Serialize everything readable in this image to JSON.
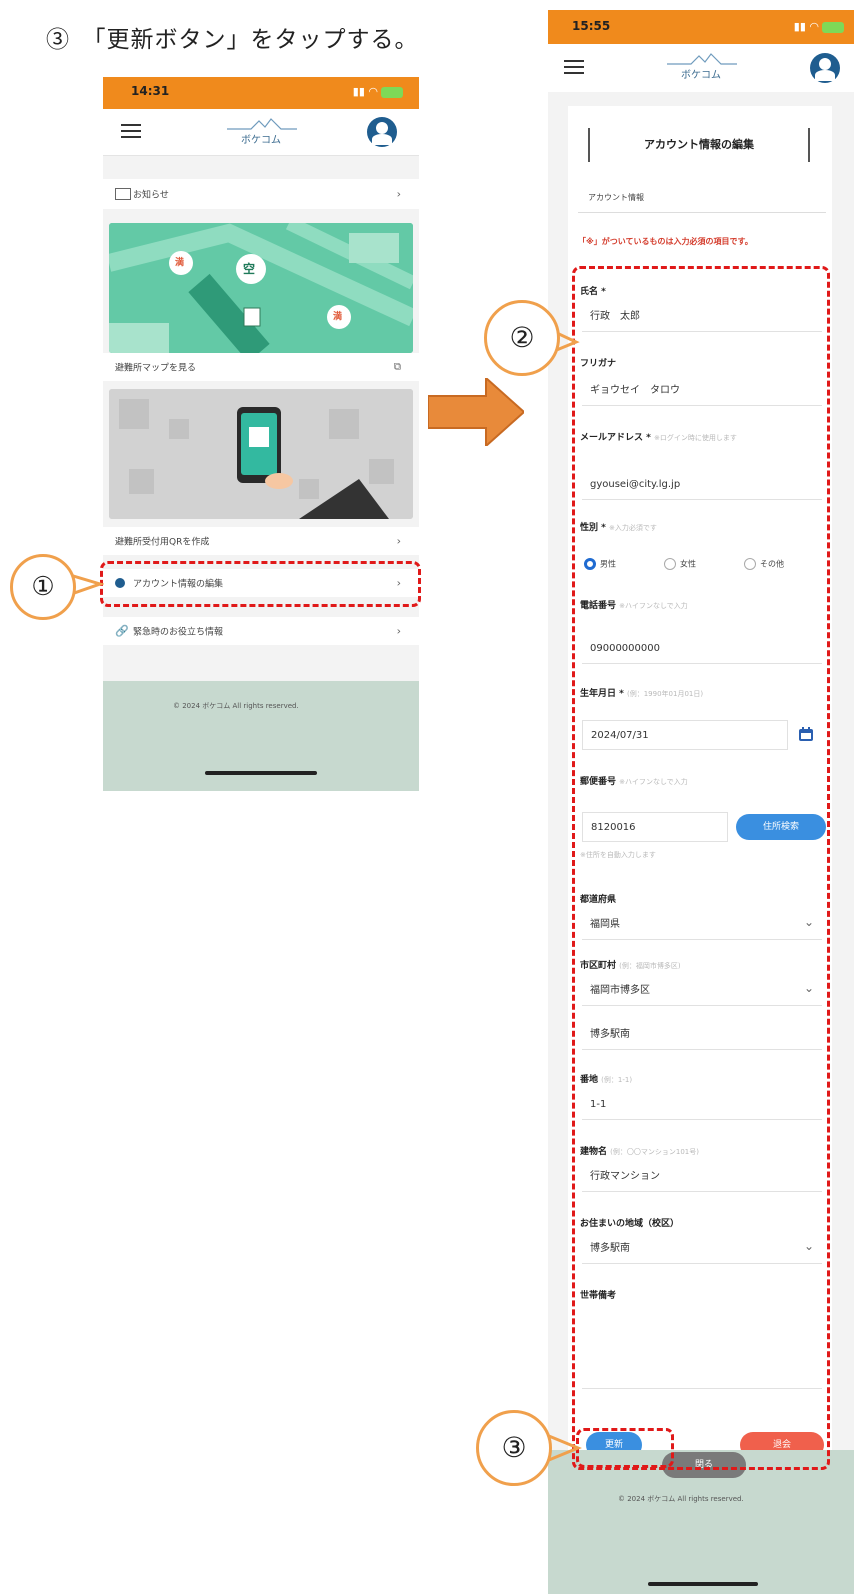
{
  "step_title": "③　「更新ボタン」をタップする。",
  "annotations": [
    "①",
    "②",
    "③"
  ],
  "phone_left": {
    "time": "14:31",
    "logo_text": "ボケコム",
    "rows": [
      {
        "label": "お知らせ",
        "icon": "news-icon"
      },
      {
        "label": "避難所マップを見る",
        "icon": "external-link-icon"
      },
      {
        "label": "避難所受付用QRを作成",
        "icon": "chevron-right-icon"
      },
      {
        "label": "アカウント情報の編集",
        "icon": "person-icon"
      },
      {
        "label": "緊急時のお役立ち情報",
        "icon": "link-icon"
      }
    ],
    "map_pins": [
      "満",
      "空",
      "満"
    ],
    "footer": "© 2024 ボケコム All rights reserved."
  },
  "phone_right": {
    "time": "15:55",
    "logo_text": "ボケコム",
    "section_title": "アカウント情報の編集",
    "account_info": "アカウント情報",
    "required_note": "「※」がついているものは入力必須の項目です。",
    "fields": {
      "name_label": "氏名",
      "name_value": "行政　太郎",
      "kana_label": "フリガナ",
      "kana_value": "ギョウセイ　タロウ",
      "email_label": "メールアドレス",
      "email_hint": "※ログイン時に使用します",
      "email_value": "gyousei@city.lg.jp",
      "gender_label": "性別",
      "gender_hint": "※入力必須です",
      "gender_options": [
        "男性",
        "女性",
        "その他"
      ],
      "phone_label": "電話番号",
      "phone_hint": "※ハイフンなしで入力",
      "phone_value": "09000000000",
      "birth_label": "生年月日",
      "birth_hint": "(例：1990年01月01日)",
      "birth_value": "2024/07/31",
      "postal_label": "郵便番号",
      "postal_hint": "※ハイフンなしで入力",
      "postal_value": "8120016",
      "postal_button": "住所検索",
      "postal_note": "※住所を自動入力します",
      "pref_label": "都道府県",
      "pref_value": "福岡県",
      "city_label": "市区町村",
      "city_hint": "(例：福岡市博多区)",
      "city_value": "福岡市博多区",
      "town_value": "博多駅南",
      "banchi_label": "番地",
      "banchi_hint": "(例：1-1)",
      "banchi_value": "1-1",
      "building_label": "建物名",
      "building_hint": "(例：〇〇マンション101号)",
      "building_value": "行政マンション",
      "area_label": "お住まいの地域（校区）",
      "area_value": "博多駅南",
      "household_label": "世帯備考"
    },
    "update_button": "更新",
    "delete_button": "退会",
    "close_button": "閉る",
    "footer": "© 2024 ボケコム All rights reserved."
  },
  "colors": {
    "status_orange": "#f08a1c",
    "annotation_red": "#e01919",
    "circle_orange": "#f0a04c",
    "update_blue": "#3a8fe0",
    "delete_red": "#f0604c",
    "arrow_orange": "#e88a3a"
  }
}
